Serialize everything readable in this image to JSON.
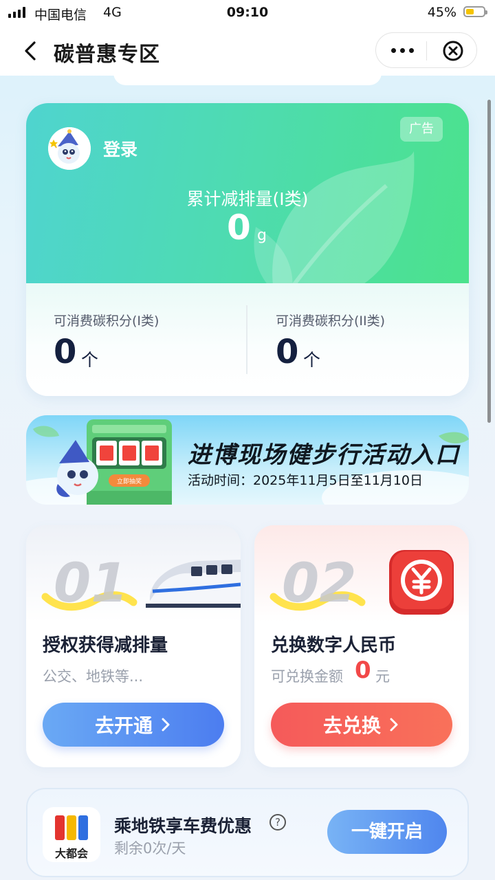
{
  "status_bar": {
    "carrier": "中国电信",
    "network": "4G",
    "time": "09:10",
    "battery_percent": "45%",
    "battery_level": 0.45,
    "battery_color": "#f5c400"
  },
  "nav": {
    "title": "碳普惠专区",
    "back_icon": "chevron-left-icon",
    "more_icon": "more-icon",
    "close_icon": "close-circle-icon"
  },
  "hero": {
    "login_label": "登录",
    "ad_badge": "广告",
    "cumulative_label": "累计减排量(I类)",
    "cumulative_value": "0",
    "cumulative_unit": "g",
    "points": [
      {
        "label": "可消费碳积分(I类)",
        "value": "0",
        "unit": "个"
      },
      {
        "label": "可消费碳积分(II类)",
        "value": "0",
        "unit": "个"
      }
    ],
    "colors": {
      "gradient_start": "#4fd4cf",
      "gradient_end": "#4be28c"
    }
  },
  "banner": {
    "title": "进博现场健步行活动入口",
    "subtitle": "活动时间：2025年11月5日至11月10日",
    "button": "立即抽奖"
  },
  "steps": [
    {
      "number": "01",
      "title": "授权获得减排量",
      "subtitle": "公交、地铁等...",
      "button": "去开通",
      "color": "#4c7df0"
    },
    {
      "number": "02",
      "title": "兑换数字人民币",
      "subtitle": "可兑换金额",
      "amount": "0",
      "amount_unit": "元",
      "button": "去兑换",
      "color": "#f55a5a"
    }
  ],
  "metro": {
    "logo_text": "大都会",
    "title": "乘地铁享车费优惠",
    "help": "?",
    "subtitle": "剩余0次/天",
    "button": "一键开启"
  }
}
